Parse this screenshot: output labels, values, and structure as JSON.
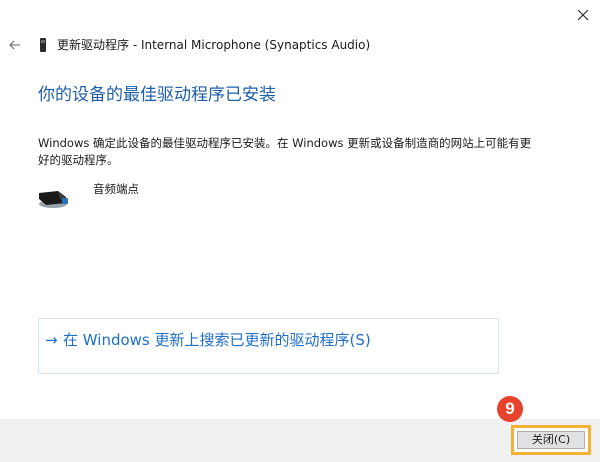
{
  "window": {
    "title": "更新驱动程序 - Internal Microphone (Synaptics Audio)",
    "close_icon": "close-icon",
    "back_icon": "back-arrow-icon"
  },
  "main": {
    "heading": "你的设备的最佳驱动程序已安装",
    "description": "Windows 确定此设备的最佳驱动程序已安装。在 Windows 更新或设备制造商的网站上可能有更好的驱动程序。",
    "device": {
      "icon": "speaker-endpoint-icon",
      "name": "音频端点"
    },
    "search_link": {
      "arrow": "→",
      "text": "在 Windows 更新上搜索已更新的驱动程序(S)"
    }
  },
  "footer": {
    "close_button_label": "关闭(C)",
    "step_badge": "9"
  },
  "colors": {
    "heading": "#1f5fa8",
    "link": "#1f6fc5",
    "highlight": "#f2b233",
    "badge": "#e8412c",
    "footer_bg": "#f0f0f0"
  }
}
